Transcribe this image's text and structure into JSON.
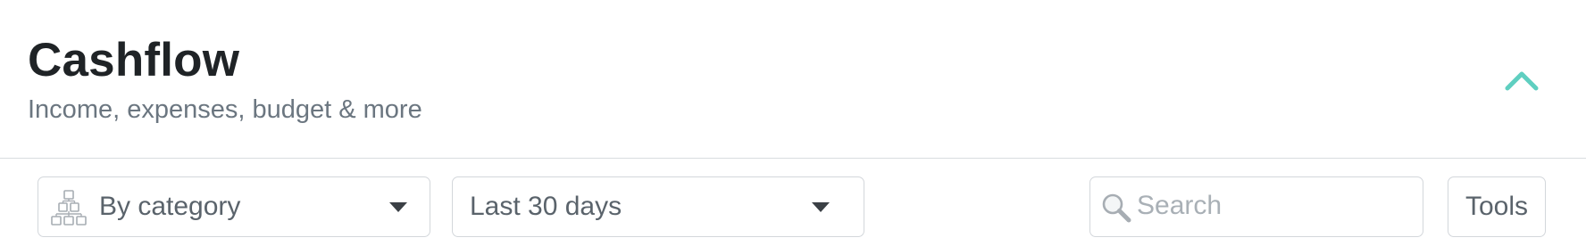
{
  "header": {
    "title": "Cashflow",
    "subtitle": "Income, expenses, budget & more",
    "collapse_icon": "chevron-up-icon",
    "accent_color": "#5fcfc0"
  },
  "toolbar": {
    "group_by": {
      "selected": "By category",
      "icon": "hierarchy-icon"
    },
    "date_range": {
      "selected": "Last 30 days"
    },
    "search": {
      "placeholder": "Search",
      "value": "",
      "icon": "search-icon"
    },
    "tools_label": "Tools"
  }
}
